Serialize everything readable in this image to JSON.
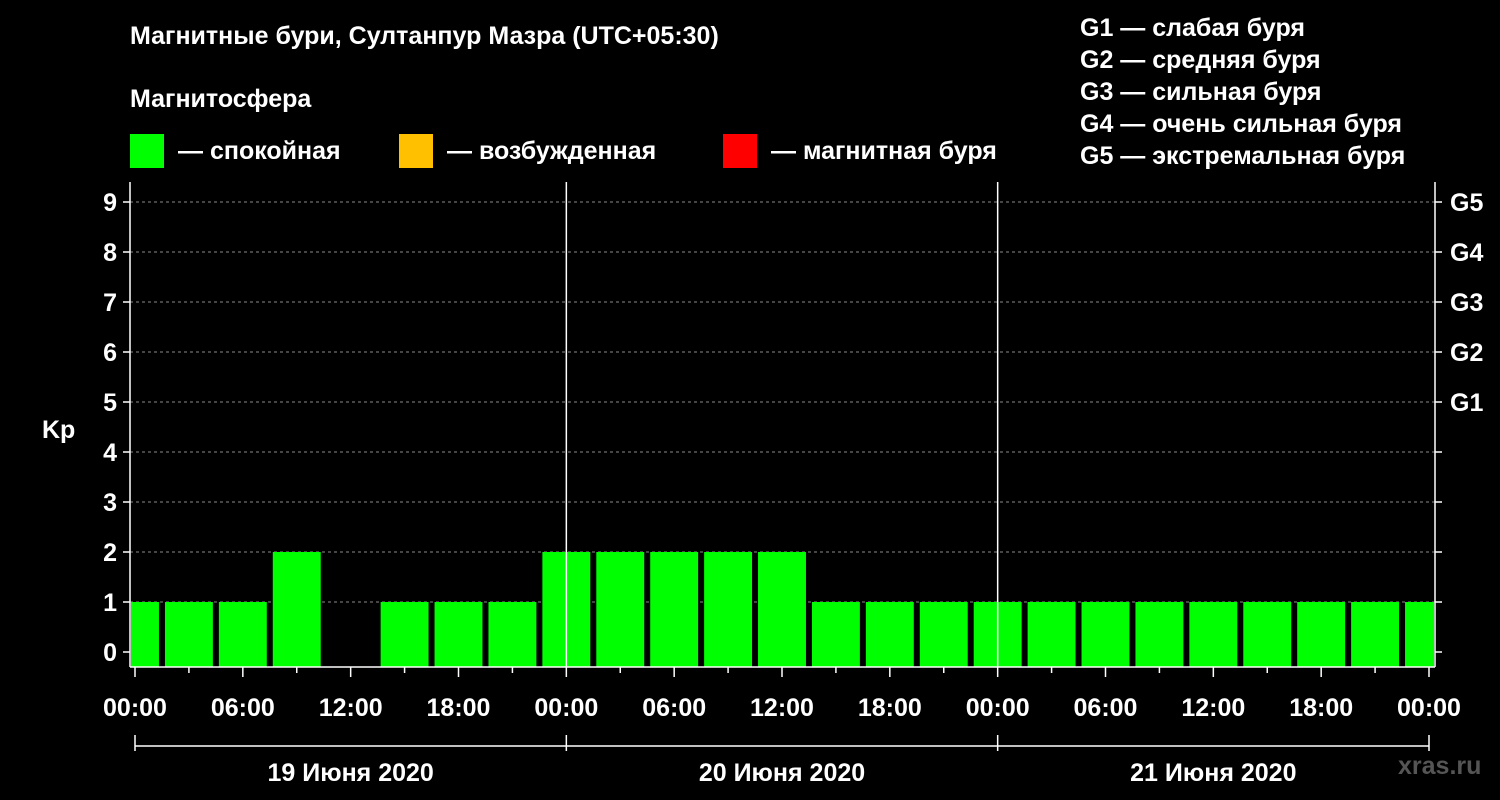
{
  "header": {
    "title": "Магнитные бури, Султанпур Мазра (UTC+05:30)",
    "subtitle": "Магнитосфера",
    "legend": [
      {
        "label": "— спокойная",
        "color": "#00ff00"
      },
      {
        "label": "— возбужденная",
        "color": "#ffc000"
      },
      {
        "label": "— магнитная буря",
        "color": "#ff0000"
      }
    ],
    "storm_levels": [
      "G1 — слабая буря",
      "G2 — средняя буря",
      "G3 — сильная буря",
      "G4 — очень сильная буря",
      "G5 — экстремальная буря"
    ]
  },
  "watermark": "xras.ru",
  "chart_data": {
    "type": "bar",
    "ylabel": "Kp",
    "ylim": [
      0,
      9
    ],
    "yticks": [
      0,
      1,
      2,
      3,
      4,
      5,
      6,
      7,
      8,
      9
    ],
    "right_tick_labels": [
      {
        "kp": 5,
        "label": "G1"
      },
      {
        "kp": 6,
        "label": "G2"
      },
      {
        "kp": 7,
        "label": "G3"
      },
      {
        "kp": 8,
        "label": "G4"
      },
      {
        "kp": 9,
        "label": "G5"
      }
    ],
    "xlim_hours": [
      0,
      72
    ],
    "xticks": [
      "00:00",
      "06:00",
      "12:00",
      "18:00",
      "00:00",
      "06:00",
      "12:00",
      "18:00",
      "00:00",
      "06:00",
      "12:00",
      "18:00",
      "00:00"
    ],
    "days": [
      "19 Июня 2020",
      "20 Июня 2020",
      "21 Июня 2020"
    ],
    "grid": true,
    "bar_start_hours": [
      -1.5,
      1.5,
      4.5,
      7.5,
      10.5,
      13.5,
      16.5,
      19.5,
      22.5,
      25.5,
      28.5,
      31.5,
      34.5,
      37.5,
      40.5,
      43.5,
      46.5,
      49.5,
      52.5,
      55.5,
      58.5,
      61.5,
      64.5,
      67.5,
      70.5
    ],
    "bar_width_hours": 3,
    "values": [
      1,
      1,
      1,
      2,
      0,
      1,
      1,
      1,
      2,
      2,
      2,
      2,
      2,
      1,
      1,
      1,
      1,
      1,
      1,
      1,
      1,
      1,
      1,
      1,
      1
    ],
    "bar_color": "#00ff00"
  }
}
